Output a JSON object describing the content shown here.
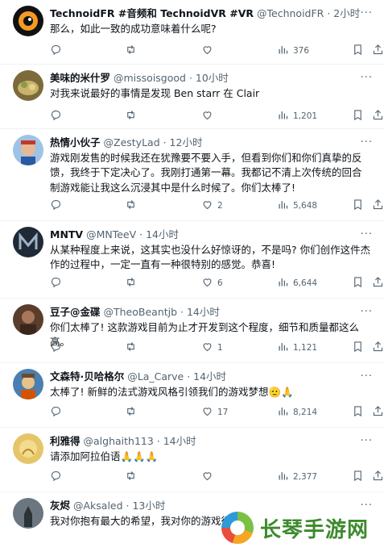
{
  "tweets": [
    {
      "name": "TechnoidFR #音频和 TechnoidVR #VR",
      "handle": "@TechnoidFR",
      "time": "2小时",
      "text": "那么，如此一致的成功意味着什么呢?",
      "replies": "",
      "retweets": "",
      "likes": "",
      "views": "376",
      "avatar": {
        "bg": "#111111",
        "fg": "#f59a23"
      }
    },
    {
      "name": "美味的米什罗",
      "handle": "@missoisgood",
      "time": "10小时",
      "text": "对我来说最好的事情是发现 Ben starr 在 Clair",
      "replies": "",
      "retweets": "",
      "likes": "",
      "views": "1,201",
      "avatar": {
        "bg": "#7d6a3a",
        "fg": "#c9b36a"
      }
    },
    {
      "name": "热情小伙子",
      "handle": "@ZestyLad",
      "time": "12小时",
      "text": "游戏刚发售的时候我还在犹豫要不要入手，但看到你们和你们真挚的反馈，我终于下定决心了。我刚打通第一幕。我都记不清上次传统的回合制游戏能让我这么沉浸其中是什么时候了。你们太棒了!",
      "replies": "",
      "retweets": "",
      "likes": "2",
      "views": "5,648",
      "avatar": {
        "bg": "#9ec3e6",
        "fg": "#c0392b"
      }
    },
    {
      "name": "MNTV",
      "handle": "@MNTeeV",
      "time": "14小时",
      "text": "从某种程度上来说，这其实也没什么好惊讶的，不是吗? 你们创作这件杰作的过程中，一定一直有一种很特别的感觉。恭喜!",
      "replies": "",
      "retweets": "",
      "likes": "6",
      "views": "6,644",
      "avatar": {
        "bg": "#1f2a36",
        "fg": "#9fb3c8"
      }
    },
    {
      "name": "豆子@金碟",
      "handle": "@TheoBeantjb",
      "time": "14小时",
      "text": "你们太棒了! 这款游戏目前为止才开发到这个程度，细节和质量都这么高。",
      "replies": "",
      "retweets": "",
      "likes": "1",
      "views": "1,121",
      "avatar": {
        "bg": "#5a3d2b",
        "fg": "#a8775a"
      }
    },
    {
      "name": "文森特·贝哈格尔",
      "handle": "@La_Carve",
      "time": "14小时",
      "text": "太棒了! 新鲜的法式游戏风格引领我们的游戏梦想🫡🙏",
      "replies": "",
      "retweets": "",
      "likes": "17",
      "views": "8,214",
      "avatar": {
        "bg": "#4a7fb0",
        "fg": "#e8c28a"
      }
    },
    {
      "name": "利雅得",
      "handle": "@alghaith113",
      "time": "14小时",
      "text": "请添加阿拉伯语🙏🙏🙏",
      "replies": "",
      "retweets": "",
      "likes": "",
      "views": "2,377",
      "avatar": {
        "bg": "#e6c56a",
        "fg": "#b58a2a"
      }
    },
    {
      "name": "灰烬",
      "handle": "@Aksaled",
      "time": "13小时",
      "text": "我对你抱有最大的希望，我对你的游戏很",
      "replies": "",
      "retweets": "",
      "likes": "",
      "views": "",
      "avatar": {
        "bg": "#6b7680",
        "fg": "#2b3238"
      }
    }
  ],
  "watermark": {
    "text": "长琴手游网"
  },
  "icons": [
    "reply-icon",
    "retweet-icon",
    "like-icon",
    "views-icon",
    "bookmark-icon",
    "share-icon",
    "more-icon"
  ],
  "colors": {
    "text": "#0f1419",
    "secondary": "#536471",
    "divider": "#eff3f4"
  }
}
